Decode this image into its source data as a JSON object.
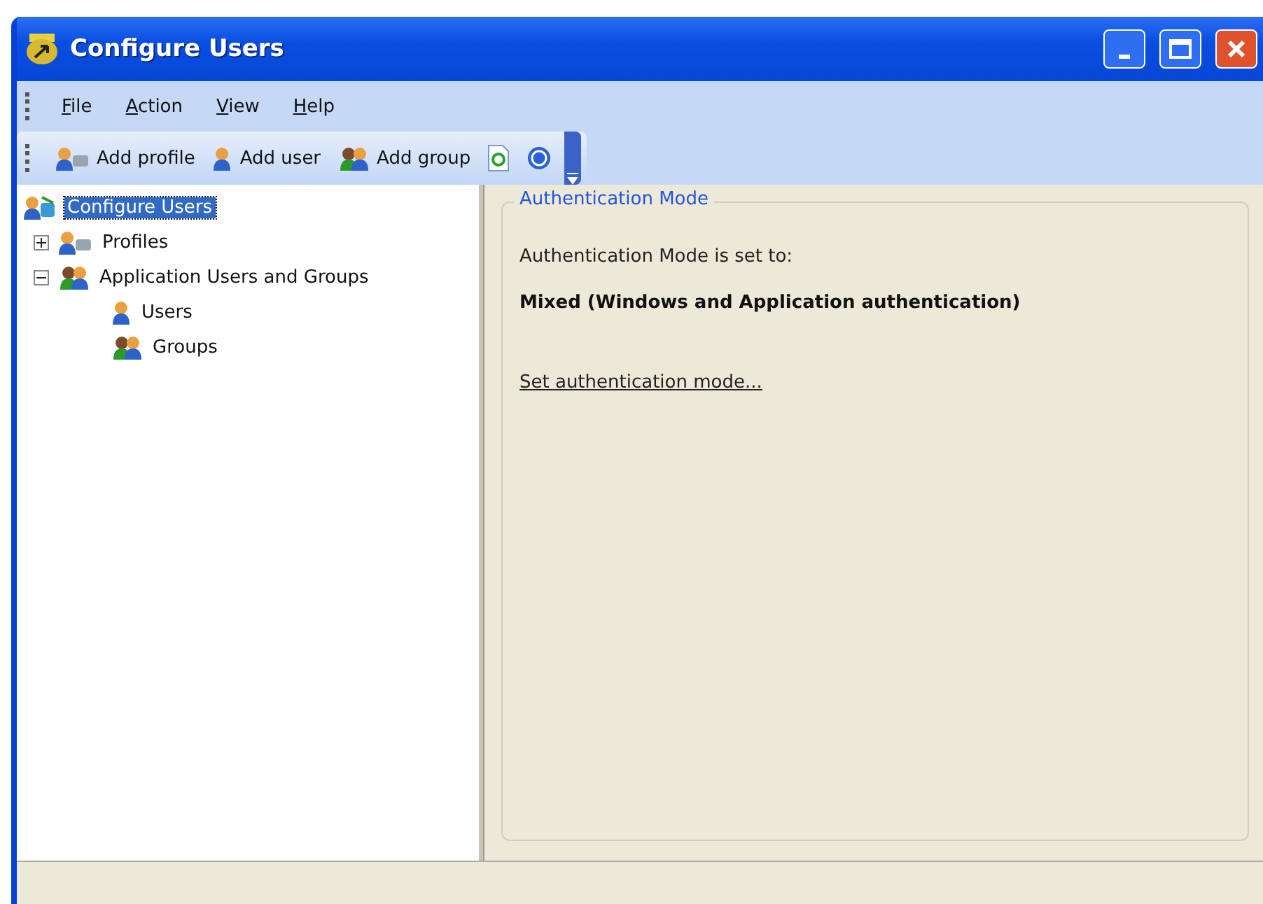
{
  "window": {
    "title": "Configure Users"
  },
  "menu": [
    {
      "label": "File"
    },
    {
      "label": "Action"
    },
    {
      "label": "View"
    },
    {
      "label": "Help"
    }
  ],
  "toolbar": [
    {
      "kind": "profile",
      "label": "Add profile"
    },
    {
      "kind": "user",
      "label": "Add user"
    },
    {
      "kind": "group",
      "label": "Add group"
    },
    {
      "kind": "refresh"
    },
    {
      "kind": "help"
    }
  ],
  "tree": [
    {
      "kind": "root",
      "label": "Configure Users",
      "selected": true,
      "children": [
        {
          "kind": "profile",
          "label": "Profiles",
          "selected": false,
          "expanded": false
        },
        {
          "kind": "group",
          "label": "Application Users and Groups",
          "selected": false,
          "expanded": true,
          "children": [
            {
              "kind": "user",
              "label": "Users",
              "selected": false
            },
            {
              "kind": "group",
              "label": "Groups",
              "selected": false
            }
          ]
        }
      ]
    }
  ],
  "panel": {
    "title": "Authentication Mode",
    "intro": "Authentication Mode is set to:",
    "mode": "Mixed (Windows and Application authentication)",
    "link": "Set authentication mode..."
  }
}
